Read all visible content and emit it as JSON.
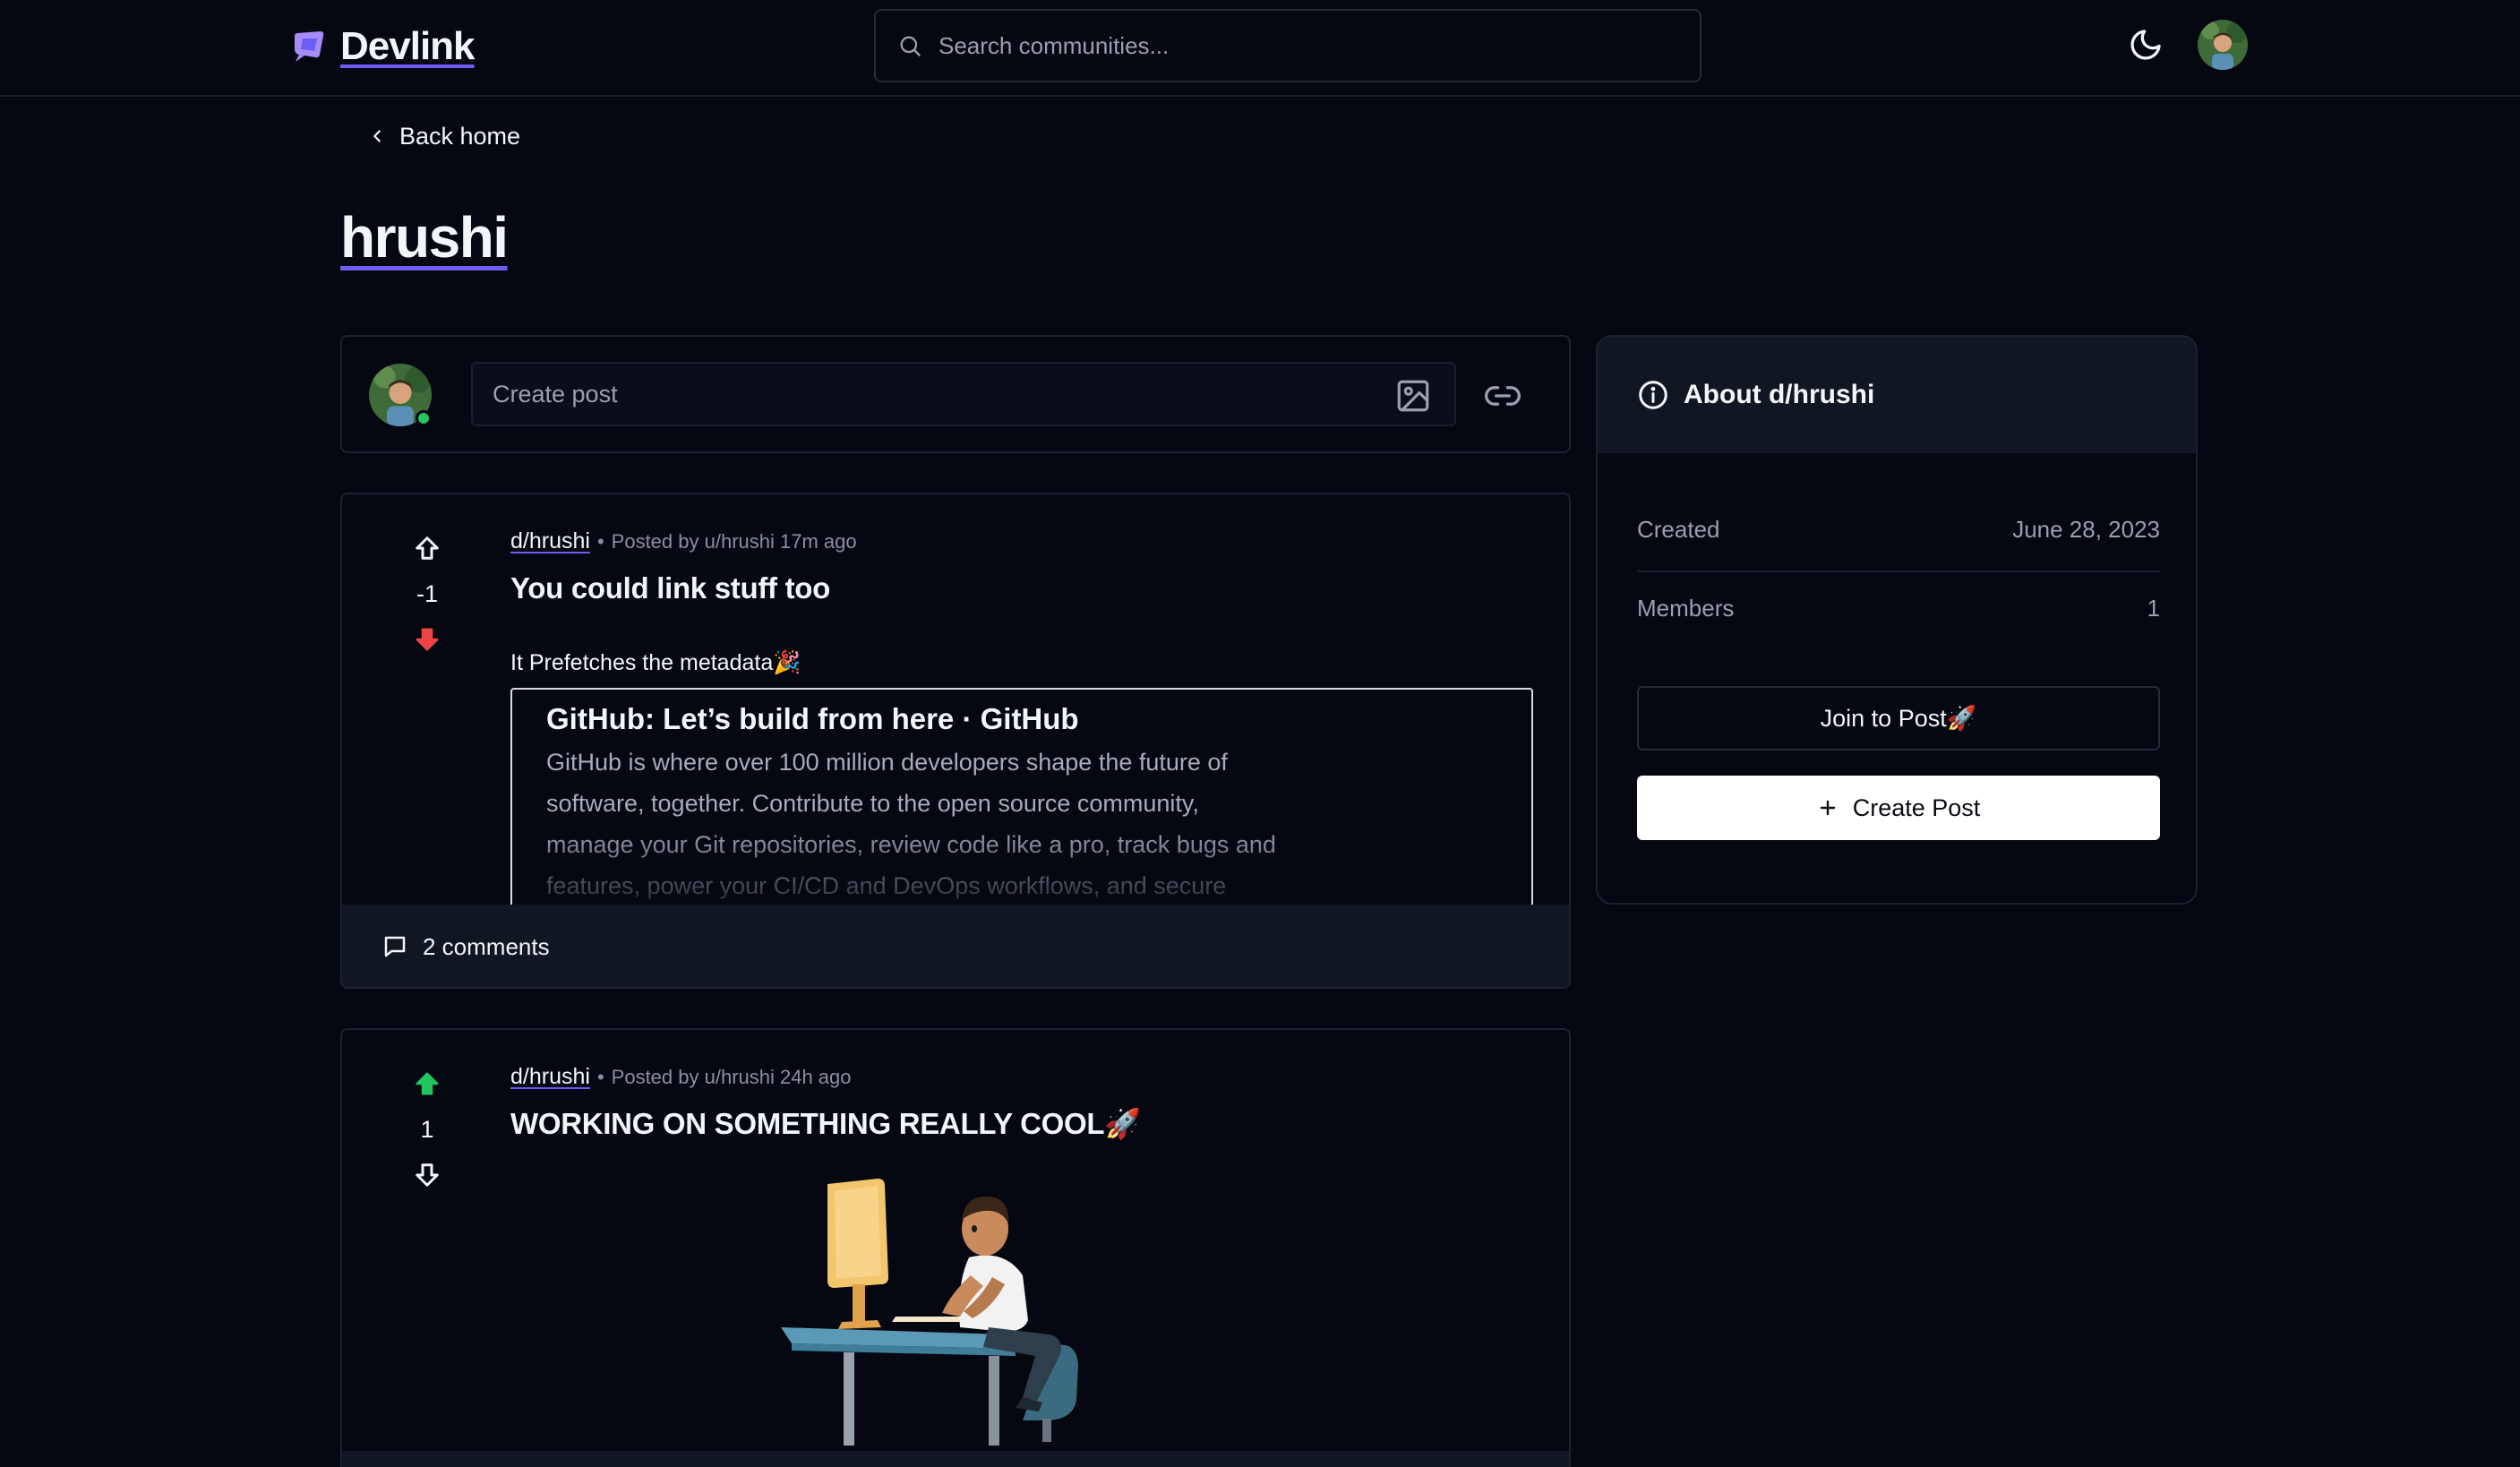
{
  "navbar": {
    "logo_text": "Devlink",
    "search_placeholder": "Search communities...",
    "theme_icon": "moon-icon",
    "avatar_icon": "user-avatar"
  },
  "header": {
    "back_label": "Back home",
    "title": "hrushi"
  },
  "create_bar": {
    "placeholder": "Create post",
    "image_icon": "image-icon",
    "link_icon": "link-icon"
  },
  "posts": [
    {
      "subreddit": "d/hrushi",
      "posted_by": "Posted by u/hrushi 17m ago",
      "title": "You could link stuff too",
      "body": "It Prefetches the metadata🎉",
      "score": "-1",
      "vote": "down",
      "link_preview": {
        "title": "GitHub: Let’s build from here · GitHub",
        "description": "GitHub is where over 100 million developers shape the future of software, together. Contribute to the open source community, manage your Git repositories, review code like a pro, track bugs and features, power your CI/CD and DevOps workflows, and secure"
      },
      "comments": "2 comments"
    },
    {
      "subreddit": "d/hrushi",
      "posted_by": "Posted by u/hrushi 24h ago",
      "title": "WORKING ON SOMETHING REALLY COOL🚀",
      "score": "1",
      "vote": "up"
    }
  ],
  "about": {
    "title": "About d/hrushi",
    "created_label": "Created",
    "created_value": "June 28, 2023",
    "members_label": "Members",
    "members_value": "1",
    "join_label": "Join to Post🚀",
    "create_label": "Create Post"
  },
  "colors": {
    "background": "#050711",
    "accent": "#6d5df5",
    "upvote": "#22c55e",
    "downvote": "#ef4444"
  }
}
